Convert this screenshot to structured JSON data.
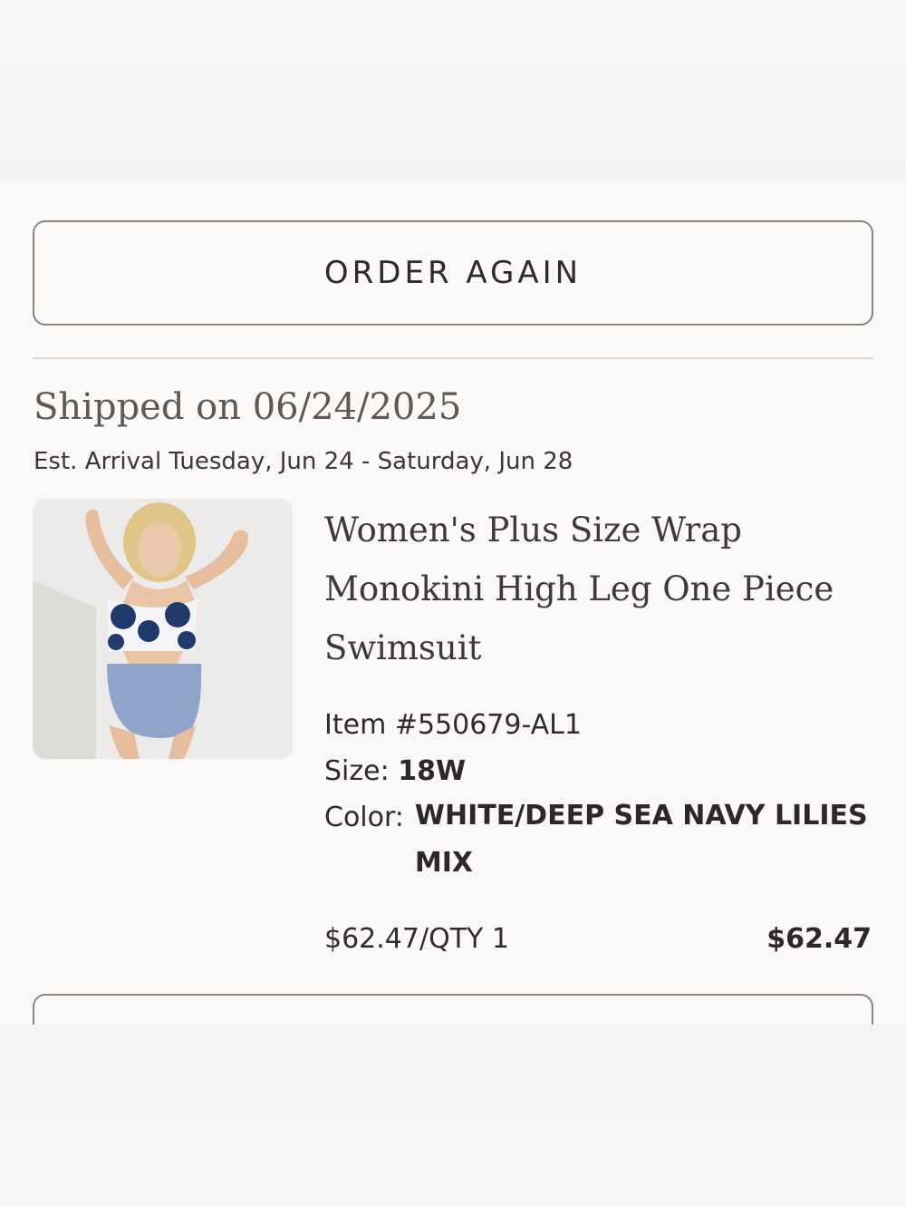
{
  "actions": {
    "order_again_label": "ORDER AGAIN"
  },
  "shipment": {
    "title": "Shipped on 06/24/2025",
    "arrival": "Est. Arrival Tuesday, Jun 24 - Saturday, Jun 28"
  },
  "product": {
    "name": "Women's Plus Size Wrap Monokini High Leg One Piece Swimsuit",
    "item_label": "Item #550679-AL1",
    "size_label": "Size:",
    "size_value": "18W",
    "color_label": "Color:",
    "color_value": "WHITE/DEEP SEA NAVY LILIES MIX",
    "unit_price_qty": "$62.47/QTY 1",
    "total_price": "$62.47"
  },
  "colors": {
    "navy": "#1f3a6b",
    "light_blue": "#8ea4c8",
    "skin": "#e9c4a6",
    "hair": "#e2c98f"
  }
}
